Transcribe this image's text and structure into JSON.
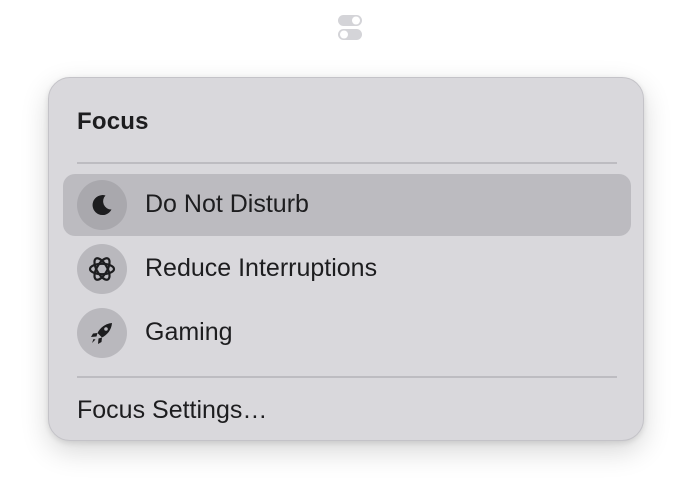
{
  "menubar": {
    "control_center_icon": "control-center-toggles-icon"
  },
  "focus_menu": {
    "title": "Focus",
    "items": [
      {
        "label": "Do Not Disturb",
        "icon": "moon-icon",
        "selected": true
      },
      {
        "label": "Reduce Interruptions",
        "icon": "atom-icon",
        "selected": false
      },
      {
        "label": "Gaming",
        "icon": "rocket-icon",
        "selected": false
      }
    ],
    "settings_label": "Focus Settings…"
  },
  "colors": {
    "menu_background": "#d9d8dc",
    "selected_row": "#bcbbc0",
    "icon_circle": "#b9b8bd",
    "text": "#1d1d1f"
  }
}
